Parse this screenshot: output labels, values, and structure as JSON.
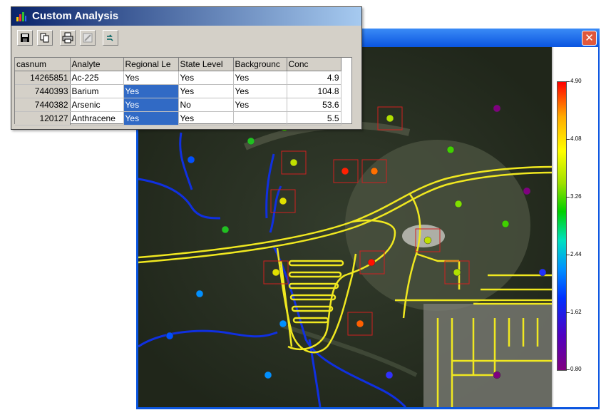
{
  "analysis_window": {
    "title": "Custom Analysis",
    "toolbar": [
      {
        "name": "save-button",
        "icon": "floppy-disk-icon"
      },
      {
        "name": "copy-button",
        "icon": "copy-icon"
      },
      {
        "name": "print-button",
        "icon": "printer-icon"
      },
      {
        "name": "edit-button",
        "icon": "pencil-icon",
        "disabled": true
      },
      {
        "name": "map-tool-button",
        "icon": "map-arrows-icon"
      }
    ],
    "table": {
      "columns": [
        "casnum",
        "Analyte",
        "Regional Le",
        "State Level",
        "Backgrounc",
        "Conc"
      ],
      "rows": [
        {
          "casnum": "14265851",
          "analyte": "Ac-225",
          "regional": "Yes",
          "state": "Yes",
          "background": "Yes",
          "conc": "4.9",
          "regional_selected": false
        },
        {
          "casnum": "7440393",
          "analyte": "Barium",
          "regional": "Yes",
          "state": "Yes",
          "background": "Yes",
          "conc": "104.8",
          "regional_selected": true
        },
        {
          "casnum": "7440382",
          "analyte": "Arsenic",
          "regional": "Yes",
          "state": "No",
          "background": "Yes",
          "conc": "53.6",
          "regional_selected": true
        },
        {
          "casnum": "120127",
          "analyte": "Anthracene",
          "regional": "Yes",
          "state": "Yes",
          "background": "",
          "conc": "5.5",
          "regional_selected": true
        }
      ]
    }
  },
  "map_window": {
    "close_label": "✕",
    "legend": {
      "ticks": [
        "4.90",
        "4.08",
        "3.26",
        "2.44",
        "1.62",
        "0.80"
      ],
      "colors": [
        "#ff0000",
        "#ffaa00",
        "#ffff00",
        "#00d000",
        "#0090ff",
        "#800080"
      ]
    },
    "colors": {
      "roads": "#f0e820",
      "streams": "#1030e0",
      "highlight_box": "#d02020"
    }
  }
}
